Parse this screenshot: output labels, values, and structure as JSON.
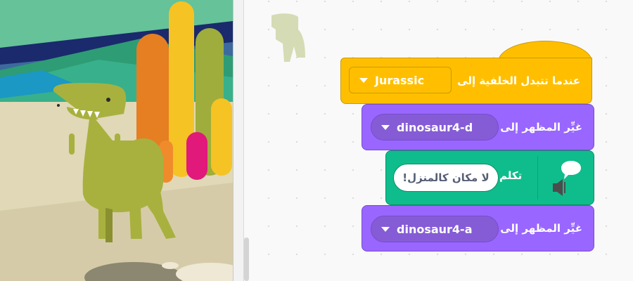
{
  "stage": {
    "sprite": "dinosaur4",
    "backdrop": "Jurassic"
  },
  "workspace": {
    "hat_block": {
      "label": "عندما تتبدل الخلفية إلى",
      "menu_value": "Jurassic"
    },
    "switch_costume_1": {
      "label": "غيِّر المظهر إلى",
      "menu_value": "dinosaur4-d"
    },
    "say_block": {
      "label": "تكلم",
      "input_value": "لا مكان كالمنزل!"
    },
    "switch_costume_2": {
      "label": "غيِّر المظهر إلى",
      "menu_value": "dinosaur4-a"
    },
    "ghost_sprite": "dinosaur4"
  },
  "colors": {
    "events": "#ffbf00",
    "looks": "#9966ff",
    "extension": "#0fbd8c"
  }
}
